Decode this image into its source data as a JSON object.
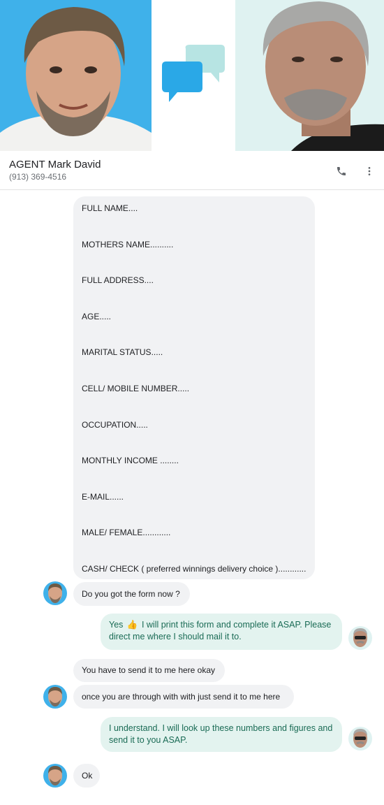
{
  "contact": {
    "name": "AGENT Mark David",
    "phone": "(913) 369-4516",
    "call_icon": "phone-icon",
    "menu_icon": "more-vert-icon"
  },
  "colors": {
    "left_photo_bg": "#3fb1ea",
    "right_photo_bg": "#dff2f1",
    "incoming_bubble": "#f1f2f4",
    "outgoing_bubble": "#e3f3ef",
    "outgoing_text": "#1a6b55"
  },
  "form_fields": [
    "FULL NAME....",
    "MOTHERS NAME..........",
    "FULL ADDRESS....",
    "AGE.....",
    "MARITAL STATUS.....",
    "CELL/ MOBILE NUMBER.....",
    "OCCUPATION.....",
    "MONTHLY INCOME ........",
    "E-MAIL......",
    "MALE/ FEMALE............",
    "CASH/ CHECK ( preferred winnings delivery choice )............"
  ],
  "messages": {
    "m1": "Do you got the form now ?",
    "m2_prefix": "Yes",
    "m2_emoji": "👍",
    "m2_rest": "I will print this form and complete it ASAP. Please direct me where I should mail it to.",
    "m3": "You have to send it to me here okay",
    "m4": "once you are through with with just send it to me here",
    "m5": "I understand. I will look up these numbers and figures and send it to you ASAP.",
    "m6": "Ok"
  }
}
